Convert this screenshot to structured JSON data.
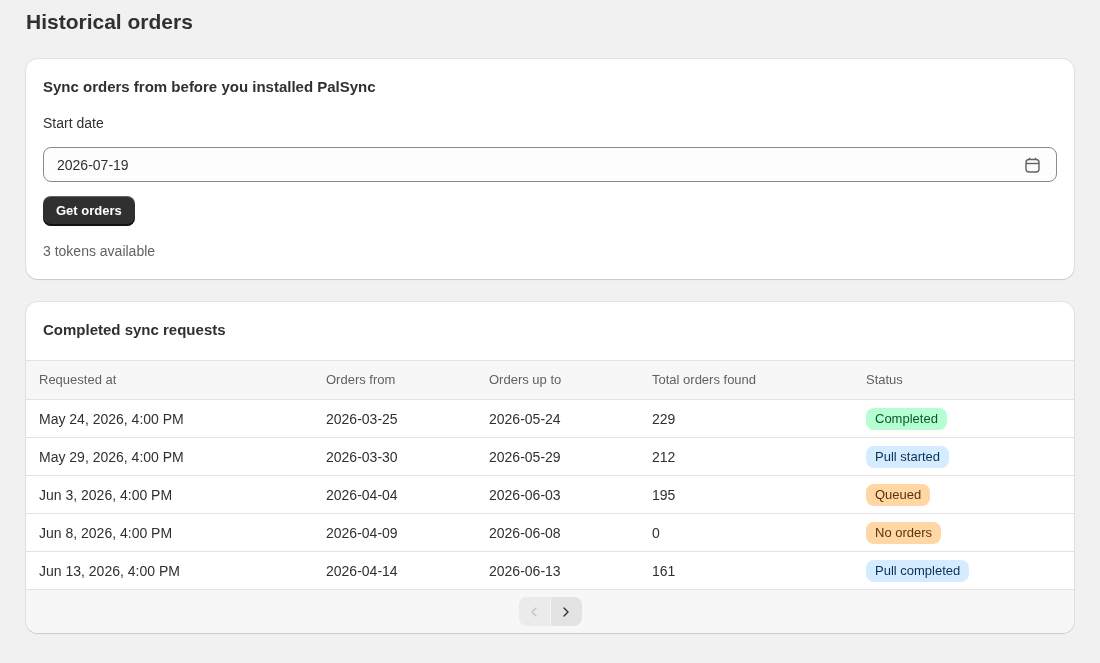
{
  "page": {
    "title": "Historical orders"
  },
  "sync_card": {
    "title": "Sync orders from before you installed PalSync",
    "start_date": {
      "label": "Start date",
      "value": "2026-07-19"
    },
    "button": "Get orders",
    "tokens": "3 tokens available"
  },
  "requests_card": {
    "title": "Completed sync requests",
    "table": {
      "columns": [
        "Requested at",
        "Orders from",
        "Orders up to",
        "Total orders found",
        "Status"
      ],
      "rows": [
        {
          "requested_at": "May 24, 2026, 4:00 PM",
          "orders_from": "2026-03-25",
          "orders_up_to": "2026-05-24",
          "total_orders_found": "229",
          "status": {
            "label": "Completed",
            "color": "#b4fed2"
          }
        },
        {
          "requested_at": "May 29, 2026, 4:00 PM",
          "orders_from": "2026-03-30",
          "orders_up_to": "2026-05-29",
          "total_orders_found": "212",
          "status": {
            "label": "Pull started",
            "color": "#d5ebff"
          }
        },
        {
          "requested_at": "Jun 3, 2026, 4:00 PM",
          "orders_from": "2026-04-04",
          "orders_up_to": "2026-06-03",
          "total_orders_found": "195",
          "status": {
            "label": "Queued",
            "color": "#ffd6a4"
          }
        },
        {
          "requested_at": "Jun 8, 2026, 4:00 PM",
          "orders_from": "2026-04-09",
          "orders_up_to": "2026-06-08",
          "total_orders_found": "0",
          "status": {
            "label": "No orders",
            "color": "#ffd6a4"
          }
        },
        {
          "requested_at": "Jun 13, 2026, 4:00 PM",
          "orders_from": "2026-04-14",
          "orders_up_to": "2026-06-13",
          "total_orders_found": "161",
          "status": {
            "label": "Pull completed",
            "color": "#d5ebff"
          }
        }
      ]
    },
    "pagination": {
      "previous": {
        "disabled": true
      },
      "next": {
        "disabled": false
      }
    }
  }
}
